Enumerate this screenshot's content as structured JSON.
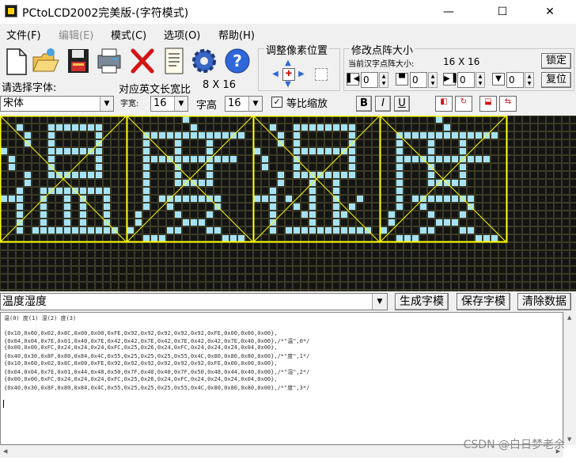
{
  "window": {
    "title": "PCtoLCD2002完美版-(字符模式)",
    "minimize": "—",
    "maximize": "☐",
    "close": "✕"
  },
  "menu": [
    {
      "label": "文件(F)",
      "enabled": true
    },
    {
      "label": "编辑(E)",
      "enabled": false
    },
    {
      "label": "模式(C)",
      "enabled": true
    },
    {
      "label": "选项(O)",
      "enabled": true
    },
    {
      "label": "帮助(H)",
      "enabled": true
    }
  ],
  "toolbar_icons": [
    "new-file-icon",
    "open-folder-icon",
    "save-disk-icon",
    "print-icon",
    "delete-icon",
    "notes-icon",
    "settings-gear-icon",
    "help-icon"
  ],
  "pixel_group": {
    "title": "调整像素位置"
  },
  "matrix_group": {
    "title": "修改点阵大小",
    "current_label": "当前汉字点阵大小:",
    "current_value": "16 X 16",
    "lock_button": "锁定",
    "restore_button": "复位",
    "spin_values": [
      "0",
      "0",
      "0",
      "0"
    ]
  },
  "font": {
    "select_label": "请选择字体:",
    "ratio_label": "对应英文长宽比",
    "ratio_value": "8 X 16",
    "font_name": "宋体",
    "width_label": "字宽:",
    "width_value": "16",
    "height_label": "字高",
    "height_value": "16",
    "scale_checkbox": "等比缩放",
    "scale_checked": true,
    "bold": "B",
    "italic": "I",
    "underline": "U"
  },
  "input": {
    "text": "温度湿度"
  },
  "actions": {
    "generate": "生成字模",
    "save": "保存字模",
    "clear": "清除数据"
  },
  "output": {
    "index_line": "温(0) 度(1) 湿(2) 度(3)",
    "lines": [
      "{0x10,0x60,0x02,0x8C,0x00,0x00,0xFE,0x92,0x92,0x92,0x92,0x92,0xFE,0x00,0x00,0x00},",
      "{0x04,0x04,0x7E,0x01,0x40,0x7E,0x42,0x42,0x7E,0x42,0x7E,0x42,0x42,0x7E,0x40,0x00},/*\"温\",0*/",
      "{0x00,0x00,0xFC,0x24,0x24,0x24,0xFC,0x25,0x26,0x24,0xFC,0x24,0x24,0x24,0x04,0x00},",
      "{0x40,0x30,0x8F,0x80,0x84,0x4C,0x55,0x25,0x25,0x25,0x55,0x4C,0x80,0x80,0x80,0x00},/*\"度\",1*/",
      "{0x10,0x60,0x02,0x8C,0x00,0xFE,0x92,0x92,0x92,0x92,0x92,0x92,0xFE,0x00,0x00,0x00},",
      "{0x04,0x04,0x7E,0x01,0x44,0x48,0x50,0x7F,0x40,0x40,0x7F,0x50,0x48,0x44,0x40,0x00},/*\"湿\",2*/",
      "{0x00,0x00,0xFC,0x24,0x24,0x24,0xFC,0x25,0x26,0x24,0xFC,0x24,0x24,0x24,0x04,0x00},",
      "{0x40,0x30,0x8F,0x80,0x84,0x4C,0x55,0x25,0x25,0x25,0x55,0x4C,0x80,0x80,0x80,0x00},/*\"度\",3*/"
    ]
  },
  "watermark": "CSDN @白日梦老余",
  "colors": {
    "grid_bg": "#3b3b26",
    "pixel_off": "#141414",
    "pixel_on": "#a6e2f6",
    "guide": "#ffff00"
  }
}
